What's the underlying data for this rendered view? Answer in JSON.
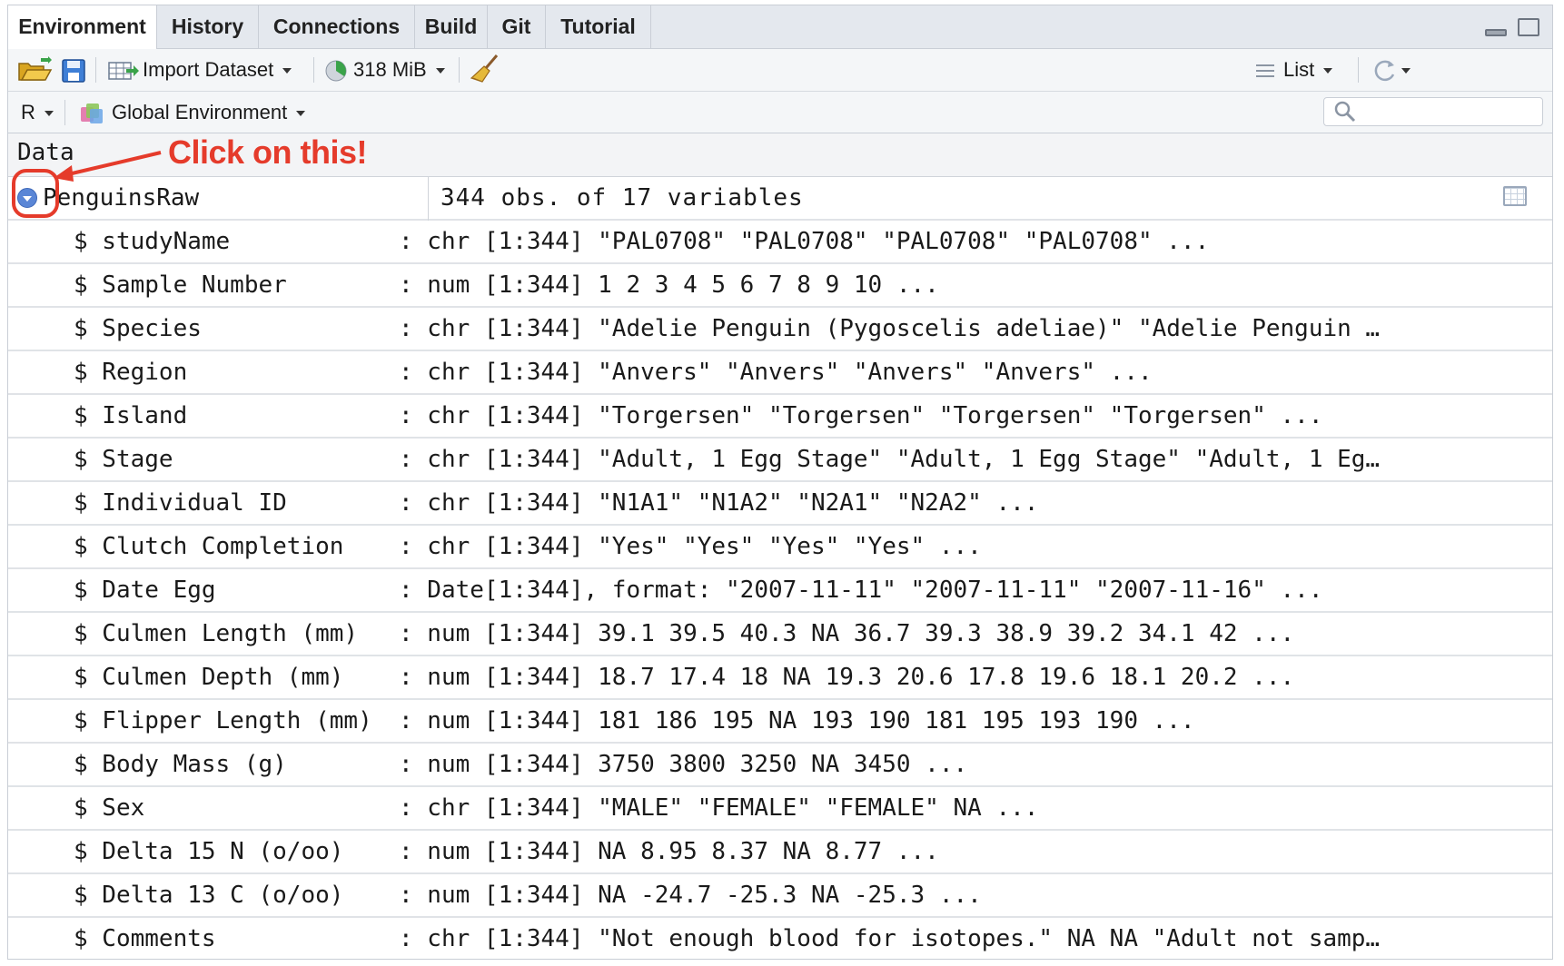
{
  "tabs": [
    {
      "label": "Environment",
      "active": true
    },
    {
      "label": "History",
      "active": false
    },
    {
      "label": "Connections",
      "active": false
    },
    {
      "label": "Build",
      "active": false
    },
    {
      "label": "Git",
      "active": false
    },
    {
      "label": "Tutorial",
      "active": false
    }
  ],
  "toolbar": {
    "import_label": "Import Dataset",
    "memory_label": "318 MiB",
    "view_label": "List"
  },
  "subbar": {
    "language": "R",
    "environment": "Global Environment",
    "search_placeholder": ""
  },
  "section": {
    "label": "Data"
  },
  "annotation": {
    "text": "Click on this!",
    "color": "#e53b2b"
  },
  "dataset": {
    "name": "PenguinsRaw",
    "summary": "344 obs. of 17 variables"
  },
  "variables": [
    {
      "name": "$ studyName",
      "value": ": chr [1:344] \"PAL0708\" \"PAL0708\" \"PAL0708\" \"PAL0708\" ..."
    },
    {
      "name": "$ Sample Number",
      "value": ": num [1:344] 1 2 3 4 5 6 7 8 9 10 ..."
    },
    {
      "name": "$ Species",
      "value": ": chr [1:344] \"Adelie Penguin (Pygoscelis adeliae)\" \"Adelie Penguin …"
    },
    {
      "name": "$ Region",
      "value": ": chr [1:344] \"Anvers\" \"Anvers\" \"Anvers\" \"Anvers\" ..."
    },
    {
      "name": "$ Island",
      "value": ": chr [1:344] \"Torgersen\" \"Torgersen\" \"Torgersen\" \"Torgersen\" ..."
    },
    {
      "name": "$ Stage",
      "value": ": chr [1:344] \"Adult, 1 Egg Stage\" \"Adult, 1 Egg Stage\" \"Adult, 1 Eg…"
    },
    {
      "name": "$ Individual ID",
      "value": ": chr [1:344] \"N1A1\" \"N1A2\" \"N2A1\" \"N2A2\" ..."
    },
    {
      "name": "$ Clutch Completion",
      "value": ": chr [1:344] \"Yes\" \"Yes\" \"Yes\" \"Yes\" ..."
    },
    {
      "name": "$ Date Egg",
      "value": ": Date[1:344], format: \"2007-11-11\" \"2007-11-11\" \"2007-11-16\" ..."
    },
    {
      "name": "$ Culmen Length (mm)",
      "value": ": num [1:344] 39.1 39.5 40.3 NA 36.7 39.3 38.9 39.2 34.1 42 ..."
    },
    {
      "name": "$ Culmen Depth (mm)",
      "value": ": num [1:344] 18.7 17.4 18 NA 19.3 20.6 17.8 19.6 18.1 20.2 ..."
    },
    {
      "name": "$ Flipper Length (mm)",
      "value": ": num [1:344] 181 186 195 NA 193 190 181 195 193 190 ..."
    },
    {
      "name": "$ Body Mass (g)",
      "value": ": num [1:344] 3750 3800 3250 NA 3450 ..."
    },
    {
      "name": "$ Sex",
      "value": ": chr [1:344] \"MALE\" \"FEMALE\" \"FEMALE\" NA ..."
    },
    {
      "name": "$ Delta 15 N (o/oo)",
      "value": ": num [1:344] NA 8.95 8.37 NA 8.77 ..."
    },
    {
      "name": "$ Delta 13 C (o/oo)",
      "value": ": num [1:344] NA -24.7 -25.3 NA -25.3 ..."
    },
    {
      "name": "$ Comments",
      "value": ": chr [1:344] \"Not enough blood for isotopes.\" NA NA \"Adult not samp…"
    }
  ],
  "icons": {
    "open": "folder-open-icon",
    "save": "save-icon",
    "import": "table-import-icon",
    "memory": "pie-chart-icon",
    "broom": "broom-icon",
    "list": "list-icon",
    "refresh": "refresh-icon",
    "environment": "environment-icon",
    "search": "search-icon",
    "view_table": "table-view-icon",
    "expand": "expand-circle-icon"
  }
}
